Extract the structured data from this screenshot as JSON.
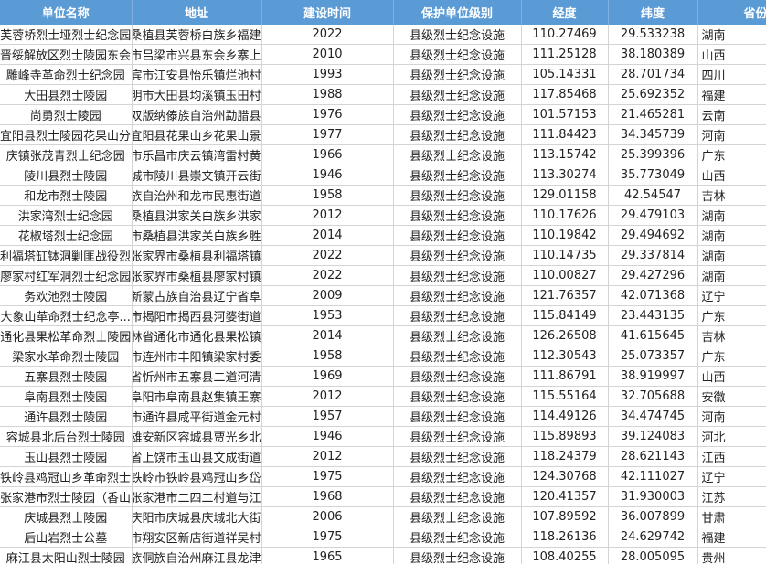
{
  "headers": [
    "单位名称",
    "地址",
    "建设时间",
    "保护单位级别",
    "经度",
    "纬度",
    "省份"
  ],
  "rows": [
    [
      "芙蓉桥烈士垭烈士纪念园",
      "湘西州桑植县芙蓉桥白族乡福建",
      "2022",
      "县级烈士纪念设施",
      "110.27469",
      "29.533238",
      "湖南"
    ],
    [
      "晋绥解放区烈士陵园东会...",
      "吕梁市吕梁市兴县东会乡寨上",
      "2010",
      "县级烈士纪念设施",
      "111.25128",
      "38.180389",
      "山西"
    ],
    [
      "雕峰寺革命烈士纪念园",
      "宜宾市江安县怡乐镇烂池村",
      "1993",
      "县级烈士纪念设施",
      "105.14331",
      "28.701734",
      "四川"
    ],
    [
      "大田县烈士陵园",
      "三明市大田县均溪镇玉田村",
      "1988",
      "县级烈士纪念设施",
      "117.85468",
      "25.692352",
      "福建"
    ],
    [
      "尚勇烈士陵园",
      "西双版纳傣族自治州勐腊县",
      "1976",
      "县级烈士纪念设施",
      "101.57153",
      "21.465281",
      "云南"
    ],
    [
      "宜阳县烈士陵园花果山分...",
      "洛阳市宜阳县花果山乡花果山景",
      "1977",
      "县级烈士纪念设施",
      "111.84423",
      "34.345739",
      "河南"
    ],
    [
      "庆镇张茂青烈士纪念园",
      "茂名市乐昌市庆云镇湾雷村黄",
      "1966",
      "县级烈士纪念设施",
      "113.15742",
      "25.399396",
      "广东"
    ],
    [
      "陵川县烈士陵园",
      "晋城市陵川县崇文镇开云街",
      "1946",
      "县级烈士纪念设施",
      "113.30274",
      "35.773049",
      "山西"
    ],
    [
      "和龙市烈士陵园",
      "延边朝鲜族自治州和龙市民惠街道",
      "1958",
      "县级烈士纪念设施",
      "129.01158",
      "42.54547",
      "吉林"
    ],
    [
      "洪家湾烈士纪念园",
      "张家界市桑植县洪家关白族乡洪家",
      "2012",
      "县级烈士纪念设施",
      "110.17626",
      "29.479103",
      "湖南"
    ],
    [
      "花椒塔烈士纪念园",
      "张家界市桑植县洪家关白族乡胜",
      "2014",
      "县级烈士纪念设施",
      "110.19842",
      "29.494692",
      "湖南"
    ],
    [
      "利福塔缸钵洞剿匪战役烈...",
      "张家界市桑植县利福塔镇",
      "2022",
      "县级烈士纪念设施",
      "110.14735",
      "29.337814",
      "湖南"
    ],
    [
      "廖家村红军洞烈士纪念园",
      "张家界市桑植县廖家村镇",
      "2022",
      "县级烈士纪念设施",
      "110.00827",
      "29.427296",
      "湖南"
    ],
    [
      "务欢池烈士陵园",
      "阜新蒙古族自治县辽宁省阜",
      "2009",
      "县级烈士纪念设施",
      "121.76357",
      "42.071368",
      "辽宁"
    ],
    [
      "大象山革命烈士纪念亭...",
      "揭阳市揭阳市揭西县河婆街道",
      "1953",
      "县级烈士纪念设施",
      "115.84149",
      "23.443135",
      "广东"
    ],
    [
      "通化县果松革命烈士陵园",
      "吉林省通化市通化县果松镇",
      "2014",
      "县级烈士纪念设施",
      "126.26508",
      "41.615645",
      "吉林"
    ],
    [
      "梁家水革命烈士陵园",
      "清远市连州市丰阳镇梁家村委",
      "1958",
      "县级烈士纪念设施",
      "112.30543",
      "25.073357",
      "广东"
    ],
    [
      "五寨县烈士陵园",
      "山西省忻州市五寨县二道河清",
      "1969",
      "县级烈士纪念设施",
      "111.86791",
      "38.919997",
      "山西"
    ],
    [
      "阜南县烈士陵园",
      "阜阳市阜阳市阜南县赵集镇王寨",
      "2012",
      "县级烈士纪念设施",
      "115.55164",
      "32.705688",
      "安徽"
    ],
    [
      "通许县烈士陵园",
      "开封市通许县咸平街道金元村",
      "1957",
      "县级烈士纪念设施",
      "114.49126",
      "34.474745",
      "河南"
    ],
    [
      "容城县北后台烈士陵园",
      "保定市雄安新区容城县贾光乡北",
      "1946",
      "县级烈士纪念设施",
      "115.89893",
      "39.124083",
      "河北"
    ],
    [
      "玉山县烈士陵园",
      "江西省上饶市玉山县文成街道",
      "2012",
      "县级烈士纪念设施",
      "118.24379",
      "28.621143",
      "江西"
    ],
    [
      "铁岭县鸡冠山乡革命烈士...",
      "铁岭市铁岭市铁岭县鸡冠山乡岱",
      "1975",
      "县级烈士纪念设施",
      "124.30768",
      "42.111027",
      "辽宁"
    ],
    [
      "张家港市烈士陵园（香山...",
      "苏州市张家港市二四二村道与江",
      "1968",
      "县级烈士纪念设施",
      "120.41357",
      "31.930003",
      "江苏"
    ],
    [
      "庆城县烈士陵园",
      "庆阳市庆阳市庆城县庆城北大街",
      "2006",
      "县级烈士纪念设施",
      "107.89592",
      "36.007899",
      "甘肃"
    ],
    [
      "后山岩烈士公墓",
      "厦门市厦门市翔安区新店街道祥吴村",
      "1975",
      "县级烈士纪念设施",
      "118.26136",
      "24.629742",
      "福建"
    ],
    [
      "麻江县太阳山烈士陵园",
      "黔东南苗族侗族自治州麻江县龙津",
      "1965",
      "县级烈士纪念设施",
      "108.40255",
      "28.005095",
      "贵州"
    ]
  ]
}
